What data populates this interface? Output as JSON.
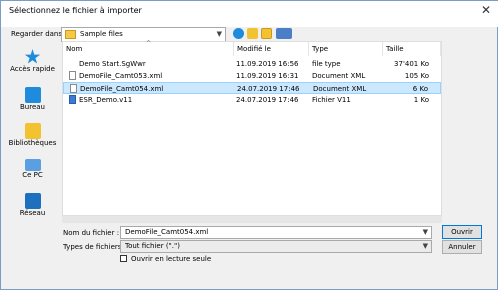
{
  "window": {
    "title": "Sélectionnez le fichier à importer",
    "close_glyph": "✕"
  },
  "toolbar": {
    "lookin_label": "Regarder dans :",
    "lookin_value": "Sample files",
    "nav_icons": [
      "back-icon",
      "up-folder-icon",
      "new-folder-icon",
      "views-menu-icon"
    ]
  },
  "places": [
    {
      "label": "Accès rapide",
      "icon": "star-icon"
    },
    {
      "label": "Bureau",
      "icon": "desktop-icon"
    },
    {
      "label": "Bibliothèques",
      "icon": "libraries-icon"
    },
    {
      "label": "Ce PC",
      "icon": "computer-icon"
    },
    {
      "label": "Réseau",
      "icon": "network-icon"
    }
  ],
  "columns": [
    "Nom",
    "Modifié le",
    "Type",
    "Taille"
  ],
  "files": [
    {
      "name": "Demo Start.SgWwr",
      "modified": "11.09.2019 16:56",
      "type": "file type",
      "size": "37'401 Ko",
      "icon": "sgwwr-file-icon",
      "selected": false
    },
    {
      "name": "DemoFile_Camt053.xml",
      "modified": "11.09.2019 16:31",
      "type": "Document XML",
      "size": "105 Ko",
      "icon": "xml-file-icon",
      "selected": false
    },
    {
      "name": "DemoFile_Camt054.xml",
      "modified": "24.07.2019 17:46",
      "type": "Document XML",
      "size": "6 Ko",
      "icon": "xml-file-icon",
      "selected": true
    },
    {
      "name": "ESR_Demo.v11",
      "modified": "24.07.2019 17:46",
      "type": "Fichier V11",
      "size": "1 Ko",
      "icon": "v11-file-icon",
      "selected": false
    }
  ],
  "form": {
    "filename_label": "Nom du fichier :",
    "filename_value": "DemoFile_Camt054.xml",
    "filetype_label": "Types de fichiers :",
    "filetype_value": "Tout fichier (\".\")",
    "readonly_label": "Ouvrir en lecture seule",
    "open_label": "Ouvrir",
    "cancel_label": "Annuler"
  },
  "colors": {
    "selection": "#cce8ff",
    "accent": "#0078d7"
  }
}
